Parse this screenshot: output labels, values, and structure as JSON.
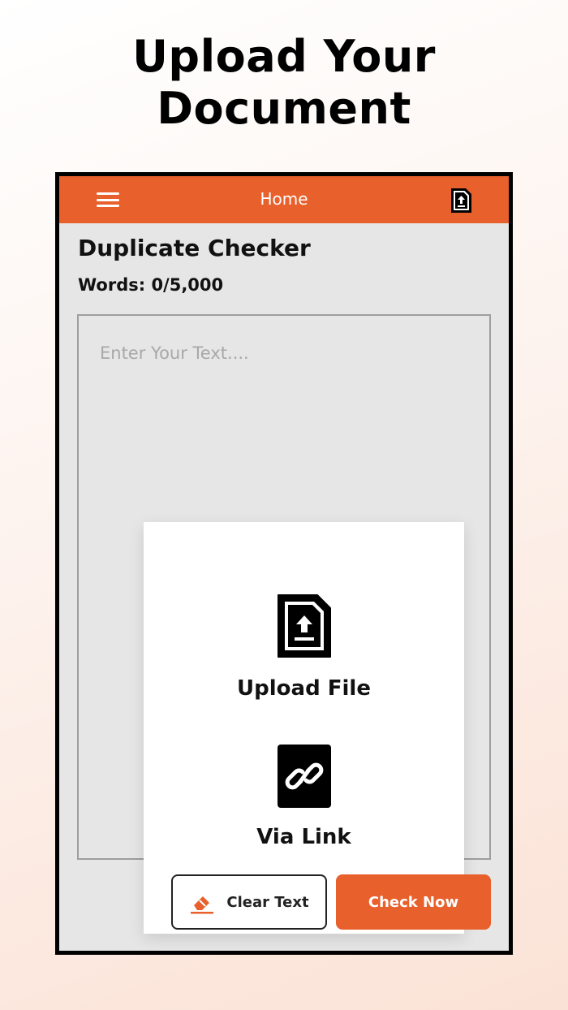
{
  "headline": {
    "line1": "Upload Your",
    "line2": "Document"
  },
  "appbar": {
    "title": "Home"
  },
  "page": {
    "title": "Duplicate Checker",
    "word_count": "Words: 0/5,000"
  },
  "editor": {
    "placeholder": "Enter Your Text...."
  },
  "upload_options": [
    {
      "label": "Upload File",
      "icon": "file-upload-icon"
    },
    {
      "label": "Via Link",
      "icon": "link-icon"
    }
  ],
  "actions": {
    "clear_label": "Clear Text",
    "check_label": "Check Now"
  },
  "colors": {
    "accent": "#e8602c",
    "background": "#e6e6e6"
  }
}
